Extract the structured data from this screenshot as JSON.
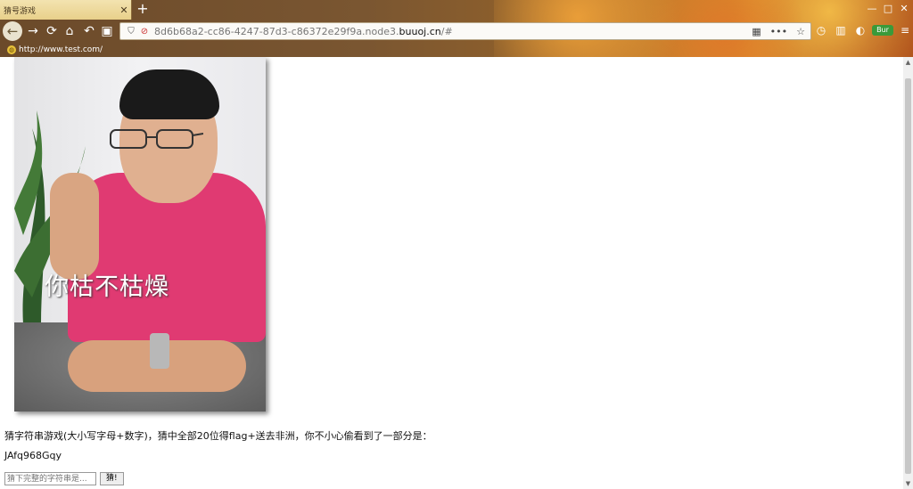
{
  "browser": {
    "tab_title": "猜号游戏",
    "tab_close": "✕",
    "new_tab": "+",
    "window_controls": [
      "—",
      "□",
      "✕"
    ],
    "nav": {
      "back": "←",
      "forward": "→",
      "reload": "⟳",
      "home": "⌂"
    },
    "url_prefix": "8d6b68a2-cc86-4247-87d3-c86372e29f9a.node3.",
    "url_domain": "buuoj.cn",
    "url_suffix": "/#",
    "url_menu": "•••",
    "bookmark_label": "http://www.test.com/",
    "extension_badge": "Bur"
  },
  "page": {
    "image_caption": "你枯不枯燥",
    "description": "猜字符串游戏(大小写字母+数字)，猜中全部20位得flag+送去非洲，你不小心偷看到了一部分是：",
    "partial_string": "JAfq968Gqy",
    "input_placeholder": "猜下完整的字符串是...",
    "submit_label": "猜!"
  }
}
